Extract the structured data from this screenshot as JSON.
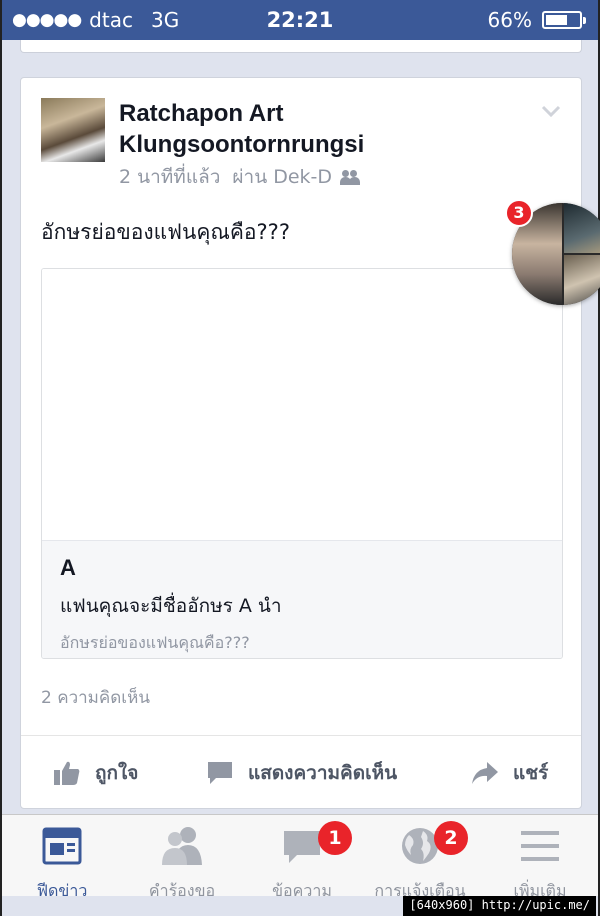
{
  "status_bar": {
    "signal": "●●●●●",
    "carrier": "dtac",
    "network": "3G",
    "time": "22:21",
    "battery_percent": "66%",
    "battery_level": 0.66
  },
  "post": {
    "author": "Ratchapon Art Klungsoontornrungsi",
    "time": "2 นาทีที่แล้ว",
    "via": "ผ่าน Dek-D",
    "text": "อักษรย่อของแฟนคุณคือ???",
    "link": {
      "title": "A",
      "description": "แฟนคุณจะมีชื่ออักษร A นำ",
      "caption": "อักษรย่อของแฟนคุณคือ???"
    },
    "comment_count": "2 ความคิดเห็น",
    "actions": {
      "like": "ถูกใจ",
      "comment": "แสดงความคิดเห็น",
      "share": "แชร์"
    }
  },
  "chat_head": {
    "badge": "3"
  },
  "tab_bar": {
    "items": [
      {
        "label": "ฟีดข่าว",
        "icon": "news-feed-icon"
      },
      {
        "label": "คำร้องขอ",
        "icon": "friend-requests-icon"
      },
      {
        "label": "ข้อความ",
        "icon": "messages-icon",
        "badge": "1"
      },
      {
        "label": "การแจ้งเตือน",
        "icon": "notifications-globe-icon",
        "badge": "2"
      },
      {
        "label": "เพิ่มเติม",
        "icon": "more-menu-icon"
      }
    ]
  },
  "watermark": "[640x960] http://upic.me/",
  "colors": {
    "brand_blue": "#3b5998",
    "badge_red": "#e9242a",
    "muted_gray": "#9197a3"
  }
}
